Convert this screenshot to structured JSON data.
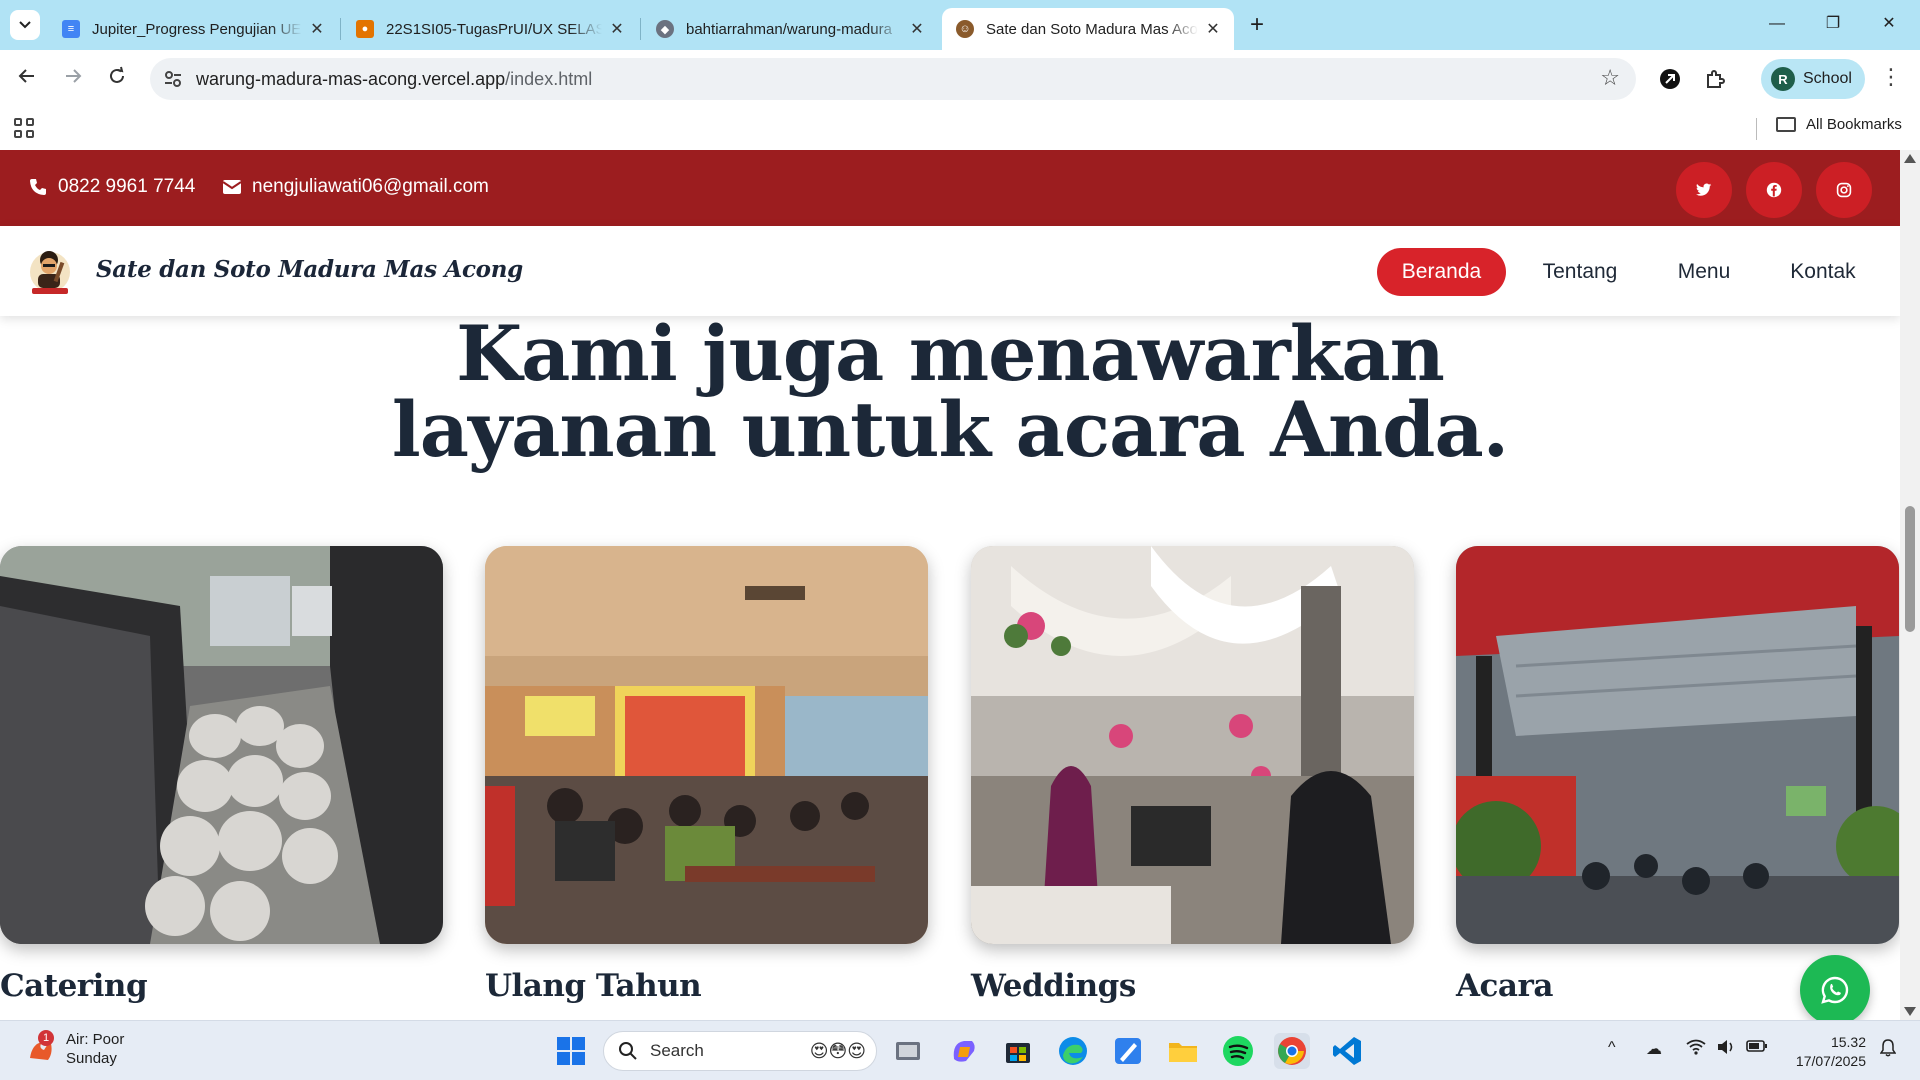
{
  "browser": {
    "tabs": [
      {
        "title": "Jupiter_Progress Pengujian UEQ",
        "icon": "google-docs-icon"
      },
      {
        "title": "22S1SI05-TugasPrUI/UX SELASA",
        "icon": "classroom-icon"
      },
      {
        "title": "bahtiarrahman/warung-madura",
        "icon": "github-icon"
      },
      {
        "title": "Sate dan Soto Madura Mas Acong",
        "icon": "site-favicon",
        "active": true
      }
    ],
    "url_host": "warung-madura-mas-acong.vercel.app",
    "url_path": "/index.html",
    "profile_initial": "R",
    "profile_name": "School",
    "all_bookmarks": "All Bookmarks"
  },
  "topbar": {
    "phone": "0822 9961 7744",
    "email": "nengjuliawati06@gmail.com",
    "social": [
      "twitter-icon",
      "facebook-icon",
      "instagram-icon"
    ],
    "bg_color": "#9c1d1f"
  },
  "nav": {
    "brand": "Sate dan Soto Madura Mas Acong",
    "links": [
      "Beranda",
      "Tentang",
      "Menu",
      "Kontak"
    ],
    "active_link": "Beranda",
    "accent": "#d8232a"
  },
  "section": {
    "headline_line1": "Kami juga menawarkan",
    "headline_line2": "layanan untuk acara Anda.",
    "cards": [
      {
        "title": "Catering"
      },
      {
        "title": "Ulang Tahun"
      },
      {
        "title": "Weddings"
      },
      {
        "title": "Acara"
      }
    ]
  },
  "taskbar": {
    "weather_title": "Air: Poor",
    "weather_sub": "Sunday",
    "weather_badge": "1",
    "search_label": "Search",
    "time": "15.32",
    "date": "17/07/2025"
  }
}
